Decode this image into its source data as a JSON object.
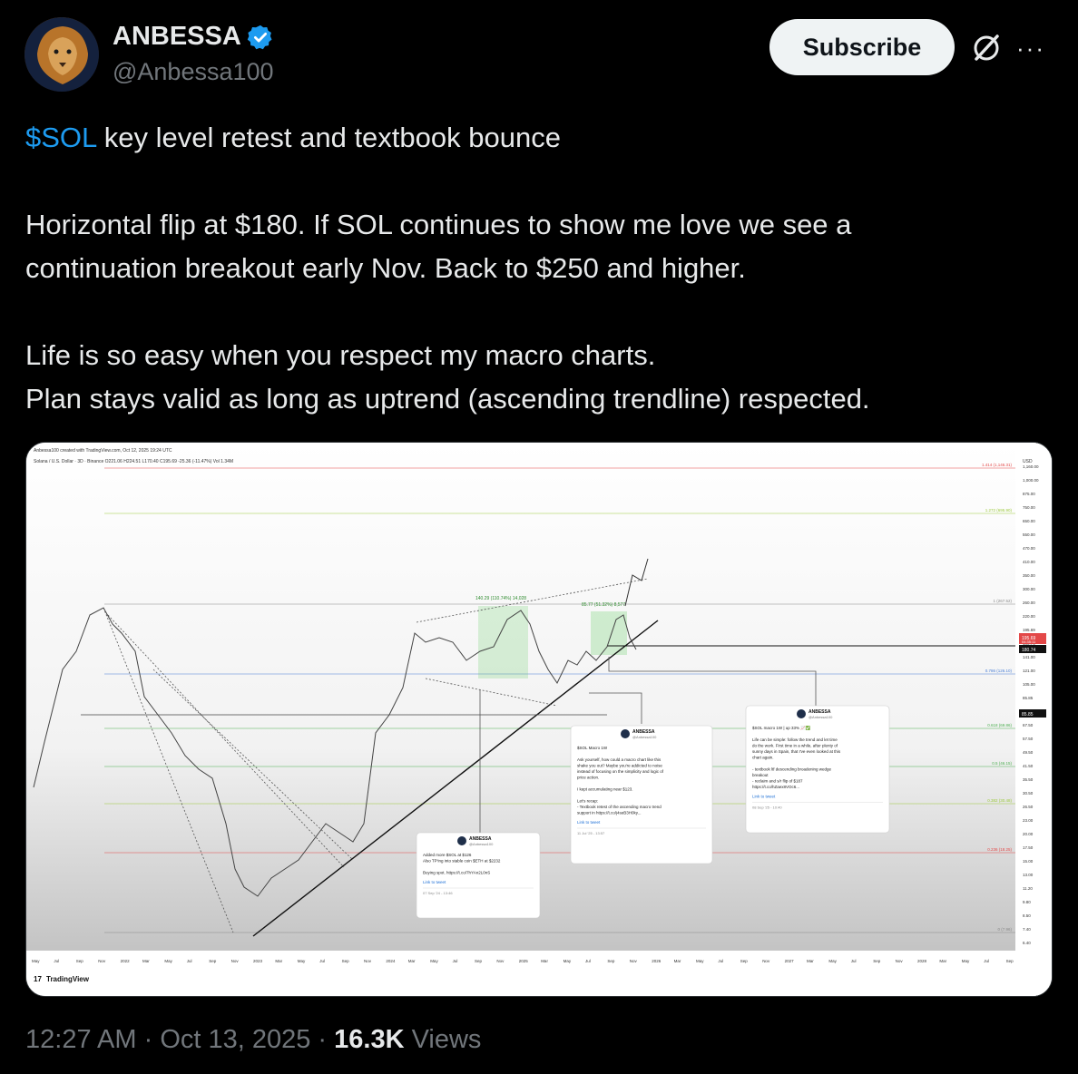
{
  "author": {
    "name": "ANBESSA",
    "handle": "@Anbessa100",
    "verified_color": "#1d9bf0",
    "avatar_icon": "lion-avatar"
  },
  "actions": {
    "subscribe_label": "Subscribe",
    "grok_icon": "grok-icon",
    "more_label": "···"
  },
  "tweet": {
    "cashtag": "$SOL",
    "line1_rest": " key level retest and textbook bounce",
    "p2_line1": "Horizontal flip at $180. If SOL continues to show me love we see a",
    "p2_line2": "continuation breakout early Nov. Back to $250 and higher.",
    "p3_line1": "Life is so easy when you respect my macro charts.",
    "p3_line2": "Plan stays valid as long as uptrend (ascending trendline) respected."
  },
  "chart": {
    "header1": "Anbessa100 created with TradingView.com, Oct 12, 2025 19:24 UTC",
    "header2": "Solana / U.S. Dollar · 3D · Binance  O221.06 H224.51 L170.40 C195.69 -25.36 (-11.47%) Vol 1.34M",
    "currency": "USD",
    "brand": "TradingView",
    "price_axis": [
      "1,160.00",
      "1,000.00",
      "875.00",
      "750.00",
      "650.00",
      "550.00",
      "470.00",
      "410.00",
      "350.00",
      "300.00",
      "260.00",
      "220.00",
      "195.69",
      "180.74",
      "141.00",
      "121.00",
      "105.00",
      "85.85",
      "77.50",
      "67.50",
      "57.50",
      "49.50",
      "41.50",
      "35.50",
      "30.50",
      "26.50",
      "23.00",
      "20.00",
      "17.50",
      "15.00",
      "13.00",
      "11.20",
      "9.80",
      "8.50",
      "7.40",
      "6.40"
    ],
    "fib_labels": [
      "1.414 (1,146.31)",
      "1.272 (695.90)",
      "1 (267.52)",
      "0.786 (126.10)",
      "0.618 (69.86)",
      "0.5 (46.15)",
      "0.382 (30.48)",
      "0.236 (18.25)",
      "0 (7.96)"
    ],
    "measure_labels": [
      "140.29 (110.74%) 14,028",
      "85.77 (51.32%) 8,577"
    ],
    "time_axis": [
      "May",
      "Jul",
      "Sep",
      "Nov",
      "2022",
      "Mar",
      "May",
      "Jul",
      "Sep",
      "Nov",
      "2023",
      "Mar",
      "May",
      "Jul",
      "Sep",
      "Nov",
      "2024",
      "Mar",
      "May",
      "Jul",
      "Sep",
      "Nov",
      "2025",
      "Mar",
      "May",
      "Jul",
      "Sep",
      "Nov",
      "2026",
      "Mar",
      "May",
      "Jul",
      "Sep",
      "Nov",
      "2027",
      "Mar",
      "May",
      "Jul",
      "Sep",
      "Nov",
      "2028",
      "Mar",
      "May",
      "Jul",
      "Sep"
    ],
    "price_badge": {
      "price": "195.69",
      "sub": "04:35:11",
      "level": "180.74",
      "low": "85.85"
    },
    "embeds": [
      {
        "name": "ANBESSA",
        "handle": "@Anbessa100",
        "lines": [
          "Added more $SOL at $126",
          "Also TP'ing into stable coin $ETH at $2232",
          "",
          "Buying spot. https://t.co/7hYAn2L0nS"
        ],
        "link": "Link to tweet",
        "date": "07 Sep '24 - 13:46"
      },
      {
        "name": "ANBESSA",
        "handle": "@Anbessa100",
        "lines": [
          "$SOL Macro 1W",
          "",
          "Ask yourself,  how could a macro chart like this",
          "shake you out? Maybe you're addicted to noise",
          "instead of focusing on the simplicity and logic of",
          "price action.",
          "",
          "I kept accumulating near $123.",
          "",
          "Let's recap:",
          "- Textbook retest of the ascending macro trend",
          "support in https://t.co/j4seB3H0ky..."
        ],
        "link": "Link to tweet",
        "date": "11 Jul '25 - 13:57"
      },
      {
        "name": "ANBESSA",
        "handle": "@Anbessa100",
        "lines": [
          "$SOL macro 1W | up 33% 📈✅",
          "",
          "Life can be simple: follow the trend and let time",
          "do the work. First time in a while, after plenty of",
          "sunny days in Spain, that I've even looked at this",
          "chart again.",
          "",
          "- textbook ltf descending broadening wedge",
          "breakout",
          "- reclaim and s/r flip of $187",
          "https://t.co/hZaex8VOc6..."
        ],
        "link": "Link to tweet",
        "date": "08 Sep '25 - 10:40"
      }
    ]
  },
  "meta": {
    "time": "12:27 AM",
    "sep": " · ",
    "date": "Oct 13, 2025",
    "views_count": "16.3K",
    "views_label": " Views"
  }
}
